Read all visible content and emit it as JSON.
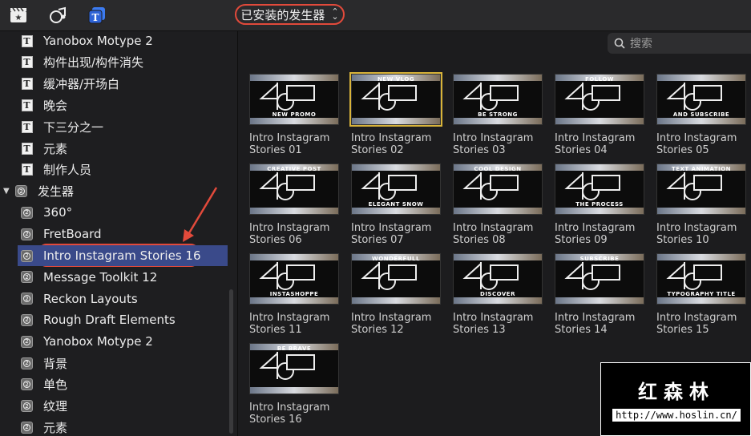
{
  "toolbar": {
    "icons": [
      "clapper-icon",
      "music-photo-icon",
      "titles-icon"
    ],
    "selector_label": "已安装的发生器"
  },
  "search": {
    "placeholder": "搜索"
  },
  "sidebar": {
    "items": [
      {
        "label": "Yanobox Motype 2",
        "icon": "T"
      },
      {
        "label": "构件出现/构件消失",
        "icon": "T"
      },
      {
        "label": "缓冲器/开场白",
        "icon": "T"
      },
      {
        "label": "晚会",
        "icon": "T"
      },
      {
        "label": "下三分之一",
        "icon": "T"
      },
      {
        "label": "元素",
        "icon": "T"
      },
      {
        "label": "制作人员",
        "icon": "T"
      },
      {
        "label": "发生器",
        "icon": "G"
      },
      {
        "label": "360°",
        "icon": "G"
      },
      {
        "label": "FretBoard",
        "icon": "G"
      },
      {
        "label": "Intro Instagram Stories 16",
        "icon": "G"
      },
      {
        "label": "Message Toolkit 12",
        "icon": "G"
      },
      {
        "label": "Reckon Layouts",
        "icon": "G"
      },
      {
        "label": "Rough Draft Elements",
        "icon": "G"
      },
      {
        "label": "Yanobox Motype 2",
        "icon": "G"
      },
      {
        "label": "背景",
        "icon": "G"
      },
      {
        "label": "单色",
        "icon": "G"
      },
      {
        "label": "纹理",
        "icon": "G"
      },
      {
        "label": "元素",
        "icon": "G"
      }
    ]
  },
  "tiles": [
    {
      "line1": "Intro Instagram",
      "line2": "Stories 01",
      "caption": "NEW PROMO"
    },
    {
      "line1": "Intro Instagram",
      "line2": "Stories 02",
      "caption": "NEW VLOG"
    },
    {
      "line1": "Intro Instagram",
      "line2": "Stories 03",
      "caption": "BE STRONG"
    },
    {
      "line1": "Intro Instagram",
      "line2": "Stories 04",
      "caption": "FOLLOW"
    },
    {
      "line1": "Intro Instagram",
      "line2": "Stories 05",
      "caption": "AND SUBSCRIBE"
    },
    {
      "line1": "Intro Instagram",
      "line2": "Stories 06",
      "caption": "CREATIVE POST"
    },
    {
      "line1": "Intro Instagram",
      "line2": "Stories 07",
      "caption": "ELEGANT SNOW"
    },
    {
      "line1": "Intro Instagram",
      "line2": "Stories 08",
      "caption": "COOL DESIGN"
    },
    {
      "line1": "Intro Instagram",
      "line2": "Stories 09",
      "caption": "THE PROCESS"
    },
    {
      "line1": "Intro Instagram",
      "line2": "Stories 10",
      "caption": "TEXT ANIMATION"
    },
    {
      "line1": "Intro Instagram",
      "line2": "Stories 11",
      "caption": "INSTASHOPPE"
    },
    {
      "line1": "Intro Instagram",
      "line2": "Stories 12",
      "caption": "WONDERFULL"
    },
    {
      "line1": "Intro Instagram",
      "line2": "Stories 13",
      "caption": "DISCOVER"
    },
    {
      "line1": "Intro Instagram",
      "line2": "Stories 14",
      "caption": "SUBSCRIBE"
    },
    {
      "line1": "Intro Instagram",
      "line2": "Stories 15",
      "caption": "TYPOGRAPHY TITLE"
    },
    {
      "line1": "Intro Instagram",
      "line2": "Stories 16",
      "caption": "BE BRAVE"
    }
  ],
  "watermark": {
    "name": "红森林",
    "url": "http://www.hoslin.cn/"
  },
  "colors": {
    "accent_red": "#e24a3b",
    "selection": "#3a4a8a",
    "selected_tile": "#d9b43a"
  }
}
